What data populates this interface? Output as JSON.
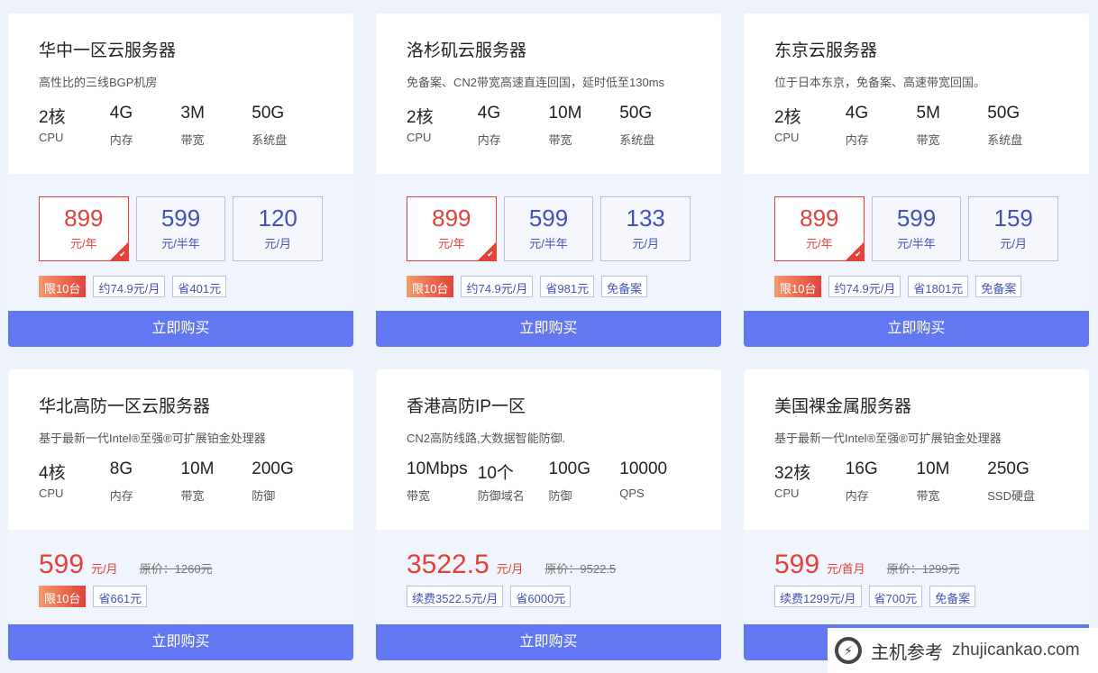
{
  "buy_label": "立即购买",
  "top_cards": [
    {
      "title": "华中一区云服务器",
      "desc": "高性比的三线BGP机房",
      "specs": [
        {
          "v": "2核",
          "l": "CPU"
        },
        {
          "v": "4G",
          "l": "内存"
        },
        {
          "v": "3M",
          "l": "带宽"
        },
        {
          "v": "50G",
          "l": "系统盘"
        }
      ],
      "options": [
        {
          "p": "899",
          "u": "元/年",
          "selected": true
        },
        {
          "p": "599",
          "u": "元/半年"
        },
        {
          "p": "120",
          "u": "元/月"
        }
      ],
      "tags": [
        "限10台",
        "约74.9元/月",
        "省401元"
      ]
    },
    {
      "title": "洛杉矶云服务器",
      "desc": "免备案、CN2带宽高速直连回国，延时低至130ms",
      "specs": [
        {
          "v": "2核",
          "l": "CPU"
        },
        {
          "v": "4G",
          "l": "内存"
        },
        {
          "v": "10M",
          "l": "带宽"
        },
        {
          "v": "50G",
          "l": "系统盘"
        }
      ],
      "options": [
        {
          "p": "899",
          "u": "元/年",
          "selected": true
        },
        {
          "p": "599",
          "u": "元/半年"
        },
        {
          "p": "133",
          "u": "元/月"
        }
      ],
      "tags": [
        "限10台",
        "约74.9元/月",
        "省981元",
        "免备案"
      ]
    },
    {
      "title": "东京云服务器",
      "desc": "位于日本东京，免备案、高速带宽回国。",
      "specs": [
        {
          "v": "2核",
          "l": "CPU"
        },
        {
          "v": "4G",
          "l": "内存"
        },
        {
          "v": "5M",
          "l": "带宽"
        },
        {
          "v": "50G",
          "l": "系统盘"
        }
      ],
      "options": [
        {
          "p": "899",
          "u": "元/年",
          "selected": true
        },
        {
          "p": "599",
          "u": "元/半年"
        },
        {
          "p": "159",
          "u": "元/月"
        }
      ],
      "tags": [
        "限10台",
        "约74.9元/月",
        "省1801元",
        "免备案"
      ]
    }
  ],
  "bottom_cards": [
    {
      "title": "华北高防一区云服务器",
      "desc": "基于最新一代Intel®至强®可扩展铂金处理器",
      "specs": [
        {
          "v": "4核",
          "l": "CPU"
        },
        {
          "v": "8G",
          "l": "内存"
        },
        {
          "v": "10M",
          "l": "带宽"
        },
        {
          "v": "200G",
          "l": "防御"
        }
      ],
      "price": "599",
      "unit": "元/月",
      "orig": "原价：1260元",
      "tags": [
        "限10台",
        "省661元"
      ]
    },
    {
      "title": "香港高防IP一区",
      "desc": "CN2高防线路,大数据智能防御.",
      "specs": [
        {
          "v": "10Mbps",
          "l": "带宽"
        },
        {
          "v": "10个",
          "l": "防御域名"
        },
        {
          "v": "100G",
          "l": "防御"
        },
        {
          "v": "10000",
          "l": "QPS"
        }
      ],
      "price": "3522.5",
      "unit": "元/月",
      "orig": "原价：9522.5",
      "tags": [
        "续费3522.5元/月",
        "省6000元"
      ]
    },
    {
      "title": "美国裸金属服务器",
      "desc": "基于最新一代Intel®至强®可扩展铂金处理器",
      "specs": [
        {
          "v": "32核",
          "l": "CPU"
        },
        {
          "v": "16G",
          "l": "内存"
        },
        {
          "v": "10M",
          "l": "带宽"
        },
        {
          "v": "250G",
          "l": "SSD硬盘"
        }
      ],
      "price": "599",
      "unit": "元/首月",
      "orig": "原价：1299元",
      "tags": [
        "续费1299元/月",
        "省700元",
        "免备案"
      ]
    }
  ],
  "watermark": {
    "cn": "主机参考",
    "en": "zhujicankao.com"
  },
  "colors": {
    "accent": "#6277f2",
    "price_red": "#e2423a",
    "price_blue": "#4452b8"
  }
}
